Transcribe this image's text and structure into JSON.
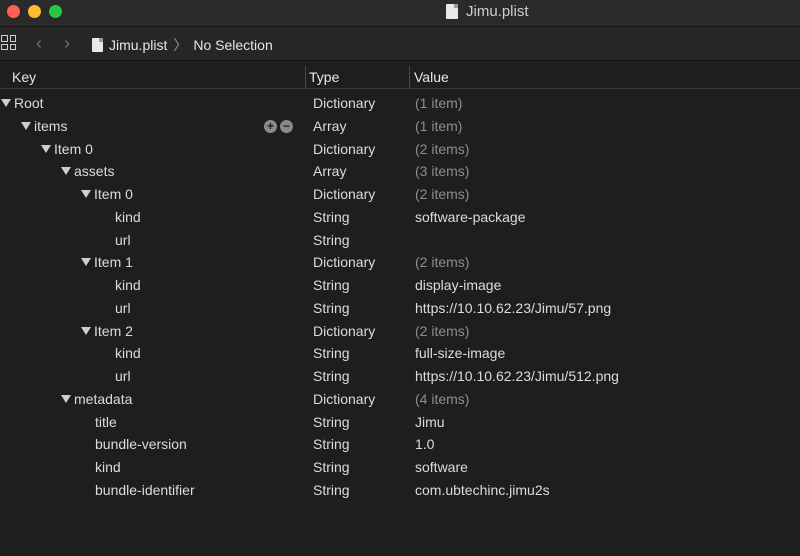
{
  "window": {
    "title": "Jimu.plist",
    "icons": {
      "doc": "document-icon"
    }
  },
  "jumpbar": {
    "grid_icon": "grid-icon",
    "back": "‹",
    "forward": "›",
    "file": "Jimu.plist",
    "separator": "〉",
    "selection": "No Selection"
  },
  "header": {
    "key": "Key",
    "type": "Type",
    "value": "Value"
  },
  "rows": [
    {
      "key": "Root",
      "type": "Dictionary",
      "value": "(1 item)"
    },
    {
      "key": "items",
      "type": "Array",
      "value": "(1 item)"
    },
    {
      "key": "Item 0",
      "type": "Dictionary",
      "value": "(2 items)"
    },
    {
      "key": "assets",
      "type": "Array",
      "value": "(3 items)"
    },
    {
      "key": "Item 0",
      "type": "Dictionary",
      "value": "(2 items)"
    },
    {
      "key": "kind",
      "type": "String",
      "value": "software-package"
    },
    {
      "key": "url",
      "type": "String",
      "value": ""
    },
    {
      "key": "Item 1",
      "type": "Dictionary",
      "value": "(2 items)"
    },
    {
      "key": "kind",
      "type": "String",
      "value": "display-image"
    },
    {
      "key": "url",
      "type": "String",
      "value": "https://10.10.62.23/Jimu/57.png"
    },
    {
      "key": "Item 2",
      "type": "Dictionary",
      "value": "(2 items)"
    },
    {
      "key": "kind",
      "type": "String",
      "value": "full-size-image"
    },
    {
      "key": "url",
      "type": "String",
      "value": "https://10.10.62.23/Jimu/512.png"
    },
    {
      "key": "metadata",
      "type": "Dictionary",
      "value": "(4 items)"
    },
    {
      "key": "title",
      "type": "String",
      "value": "Jimu"
    },
    {
      "key": "bundle-version",
      "type": "String",
      "value": "1.0"
    },
    {
      "key": "kind",
      "type": "String",
      "value": "software"
    },
    {
      "key": "bundle-identifier",
      "type": "String",
      "value": "com.ubtechinc.jimu2s"
    }
  ],
  "row_tools": {
    "add": "+",
    "remove": "−"
  }
}
